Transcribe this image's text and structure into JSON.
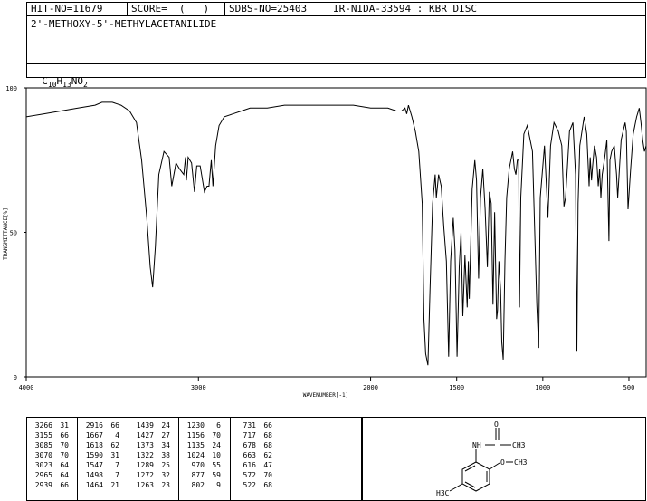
{
  "header": {
    "hit_no": "HIT-NO=11679",
    "score": "SCORE=  (   )",
    "sdbs_no": "SDBS-NO=25403",
    "ir_nida": "IR-NIDA-33594 : KBR DISC",
    "compound_name": "2'-METHOXY-5'-METHYLACETANILIDE",
    "formula_parts": [
      "C",
      "10",
      "H",
      "13",
      "NO",
      "2"
    ]
  },
  "chart_data": {
    "type": "line",
    "xlabel": "WAVENUMBER[-1]",
    "ylabel": "TRANSMITTANCE[%]",
    "xlim": [
      4000,
      400
    ],
    "ylim": [
      0,
      100
    ],
    "x_ticks": [
      4000,
      3000,
      2000,
      1500,
      1000,
      500
    ],
    "y_ticks": [
      0,
      50,
      100
    ],
    "series": [
      {
        "x": [
          4000,
          3900,
          3800,
          3700,
          3600,
          3560,
          3500,
          3450,
          3400,
          3360,
          3330,
          3300,
          3280,
          3266,
          3250,
          3230,
          3200,
          3170,
          3155,
          3130,
          3110,
          3085,
          3075,
          3070,
          3060,
          3040,
          3023,
          3010,
          2990,
          2965,
          2950,
          2939,
          2925,
          2916,
          2900,
          2880,
          2850,
          2800,
          2750,
          2700,
          2600,
          2500,
          2400,
          2300,
          2200,
          2100,
          2000,
          1900,
          1850,
          1820,
          1800,
          1790,
          1780,
          1760,
          1740,
          1720,
          1700,
          1690,
          1680,
          1667,
          1655,
          1640,
          1625,
          1618,
          1605,
          1590,
          1575,
          1560,
          1547,
          1535,
          1520,
          1510,
          1498,
          1485,
          1475,
          1464,
          1452,
          1439,
          1432,
          1427,
          1410,
          1395,
          1385,
          1373,
          1362,
          1348,
          1335,
          1322,
          1310,
          1300,
          1289,
          1280,
          1272,
          1268,
          1263,
          1255,
          1245,
          1238,
          1230,
          1220,
          1210,
          1195,
          1175,
          1165,
          1156,
          1148,
          1140,
          1135,
          1128,
          1110,
          1090,
          1060,
          1035,
          1024,
          1015,
          990,
          970,
          955,
          935,
          910,
          890,
          877,
          868,
          845,
          825,
          810,
          802,
          795,
          785,
          760,
          745,
          731,
          725,
          717,
          712,
          700,
          688,
          678,
          670,
          663,
          655,
          640,
          628,
          616,
          610,
          600,
          585,
          572,
          565,
          545,
          530,
          522,
          515,
          505,
          490,
          475,
          455,
          440,
          430,
          420,
          410,
          400
        ],
        "y": [
          90,
          91,
          92,
          93,
          94,
          95,
          95,
          94,
          92,
          88,
          75,
          55,
          38,
          31,
          45,
          70,
          78,
          76,
          66,
          74,
          72,
          70,
          76,
          68,
          76,
          74,
          64,
          73,
          73,
          64,
          66,
          66,
          75,
          66,
          80,
          87,
          90,
          91,
          92,
          93,
          93,
          94,
          94,
          94,
          94,
          94,
          93,
          93,
          92,
          92,
          93,
          91,
          94,
          90,
          85,
          78,
          60,
          20,
          8,
          4,
          30,
          60,
          70,
          62,
          70,
          66,
          52,
          40,
          7,
          40,
          55,
          44,
          7,
          38,
          50,
          21,
          42,
          24,
          40,
          27,
          65,
          75,
          68,
          34,
          62,
          72,
          58,
          38,
          64,
          60,
          25,
          57,
          32,
          20,
          23,
          40,
          30,
          12,
          6,
          40,
          62,
          72,
          78,
          72,
          70,
          75,
          75,
          24,
          62,
          84,
          87,
          78,
          25,
          10,
          62,
          80,
          55,
          80,
          88,
          85,
          80,
          59,
          62,
          85,
          88,
          70,
          9,
          60,
          80,
          90,
          84,
          66,
          76,
          68,
          72,
          80,
          76,
          66,
          72,
          62,
          70,
          76,
          82,
          47,
          75,
          78,
          80,
          70,
          62,
          82,
          86,
          88,
          85,
          58,
          72,
          84,
          90,
          93,
          88,
          82,
          78,
          80
        ]
      }
    ]
  },
  "peak_table": [
    [
      [
        "3266",
        "31"
      ],
      [
        "3155",
        "66"
      ],
      [
        "3085",
        "70"
      ],
      [
        "3070",
        "70"
      ],
      [
        "3023",
        "64"
      ],
      [
        "2965",
        "64"
      ],
      [
        "2939",
        "66"
      ]
    ],
    [
      [
        "2916",
        "66"
      ],
      [
        "1667",
        "4"
      ],
      [
        "1618",
        "62"
      ],
      [
        "1590",
        "31"
      ],
      [
        "1547",
        "7"
      ],
      [
        "1498",
        "7"
      ],
      [
        "1464",
        "21"
      ]
    ],
    [
      [
        "1439",
        "24"
      ],
      [
        "1427",
        "27"
      ],
      [
        "1373",
        "34"
      ],
      [
        "1322",
        "38"
      ],
      [
        "1289",
        "25"
      ],
      [
        "1272",
        "32"
      ],
      [
        "1263",
        "23"
      ]
    ],
    [
      [
        "1230",
        "6"
      ],
      [
        "1156",
        "70"
      ],
      [
        "1135",
        "24"
      ],
      [
        "1024",
        "10"
      ],
      [
        "970",
        "55"
      ],
      [
        "877",
        "59"
      ],
      [
        "802",
        "9"
      ]
    ],
    [
      [
        "731",
        "66"
      ],
      [
        "717",
        "68"
      ],
      [
        "678",
        "68"
      ],
      [
        "663",
        "62"
      ],
      [
        "616",
        "47"
      ],
      [
        "572",
        "70"
      ],
      [
        "522",
        "68"
      ]
    ]
  ],
  "structure": {
    "atoms": {
      "o_carbonyl": "O",
      "nh": "NH",
      "ch3_acetyl": "CH3",
      "o_methoxy": "O",
      "ch3_methoxy": "CH3",
      "h3c_ring": "H3C"
    }
  }
}
